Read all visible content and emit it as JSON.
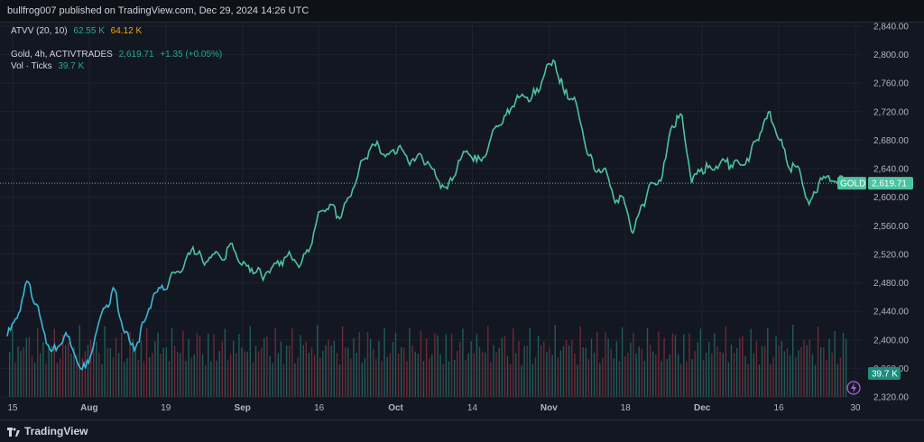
{
  "header": {
    "published": "bullfrog007 published on TradingView.com, Dec 29, 2024 14:26 UTC"
  },
  "legend": {
    "atvv_name": "ATVV (20, 10)",
    "atvv_val1": "62.55 K",
    "atvv_val2": "64.12 K",
    "symbol": "Gold, 4h, ACTIVTRADES",
    "price": "2,619.71",
    "change": "+1.35 (+0.05%)",
    "vol_name": "Vol · Ticks",
    "vol_val": "39.7 K"
  },
  "price_tag": {
    "symbol": "GOLD",
    "price": "2,619.71",
    "vol": "39.7 K"
  },
  "footer": {
    "brand": "TradingView"
  },
  "colors": {
    "line": "#4cc3a0",
    "line_early": "#3fb7d6",
    "vol_up": "#1f5c57",
    "vol_down": "#6b2a35",
    "green_text": "#22ab94",
    "orange_text": "#f7a600"
  },
  "chart_data": {
    "type": "line",
    "series": [
      {
        "name": "Gold, 4h, ACTIVTRADES",
        "x": [
          "Jul 15",
          "Jul 17",
          "Jul 18",
          "Jul 20",
          "Jul 22",
          "Jul 24",
          "Jul 25",
          "Jul 27",
          "Jul 29",
          "Jul 31",
          "Aug 1",
          "Aug 3",
          "Aug 5",
          "Aug 7",
          "Aug 8",
          "Aug 10",
          "Aug 12",
          "Aug 14",
          "Aug 15",
          "Aug 17",
          "Aug 19",
          "Aug 21",
          "Aug 22",
          "Aug 24",
          "Aug 26",
          "Aug 28",
          "Aug 30",
          "Sep 1",
          "Sep 3",
          "Sep 5",
          "Sep 7",
          "Sep 9",
          "Sep 11",
          "Sep 13",
          "Sep 15",
          "Sep 17",
          "Sep 19",
          "Sep 21",
          "Sep 23",
          "Sep 25",
          "Sep 27",
          "Sep 29",
          "Oct 1",
          "Oct 3",
          "Oct 5",
          "Oct 7",
          "Oct 9",
          "Oct 11",
          "Oct 13",
          "Oct 15",
          "Oct 17",
          "Oct 19",
          "Oct 21",
          "Oct 23",
          "Oct 25",
          "Oct 27",
          "Oct 29",
          "Oct 31",
          "Nov 2",
          "Nov 4",
          "Nov 6",
          "Nov 8",
          "Nov 10",
          "Nov 12",
          "Nov 14",
          "Nov 16",
          "Nov 18",
          "Nov 20",
          "Nov 22",
          "Nov 24",
          "Nov 26",
          "Nov 28",
          "Nov 30",
          "Dec 2",
          "Dec 4",
          "Dec 6",
          "Dec 8",
          "Dec 10",
          "Dec 12",
          "Dec 14",
          "Dec 16",
          "Dec 18",
          "Dec 20",
          "Dec 22",
          "Dec 24",
          "Dec 26",
          "Dec 28"
        ],
        "values": [
          2405,
          2430,
          2482,
          2450,
          2395,
          2385,
          2410,
          2375,
          2360,
          2405,
          2445,
          2470,
          2410,
          2385,
          2425,
          2465,
          2470,
          2495,
          2500,
          2530,
          2510,
          2520,
          2512,
          2535,
          2505,
          2500,
          2490,
          2500,
          2510,
          2518,
          2505,
          2530,
          2580,
          2590,
          2570,
          2600,
          2640,
          2665,
          2672,
          2660,
          2670,
          2650,
          2660,
          2650,
          2625,
          2612,
          2640,
          2665,
          2650,
          2660,
          2700,
          2715,
          2735,
          2740,
          2745,
          2775,
          2790,
          2745,
          2740,
          2680,
          2640,
          2640,
          2600,
          2600,
          2550,
          2590,
          2620,
          2630,
          2700,
          2715,
          2620,
          2640,
          2640,
          2650,
          2645,
          2645,
          2660,
          2690,
          2720,
          2680,
          2640,
          2640,
          2590,
          2620,
          2630,
          2625,
          2619.71
        ]
      }
    ],
    "y_axis": {
      "ticks": [
        "2,320.00",
        "2,360.00",
        "2,400.00",
        "2,440.00",
        "2,480.00",
        "2,520.00",
        "2,560.00",
        "2,600.00",
        "2,640.00",
        "2,680.00",
        "2,720.00",
        "2,760.00",
        "2,800.00",
        "2,840.00"
      ],
      "range": [
        2320,
        2845
      ]
    },
    "x_axis": {
      "ticks": [
        "15",
        "Aug",
        "19",
        "Sep",
        "16",
        "Oct",
        "14",
        "Nov",
        "18",
        "Dec",
        "16",
        "30"
      ]
    },
    "last_price": 2619.71,
    "grid": true
  }
}
